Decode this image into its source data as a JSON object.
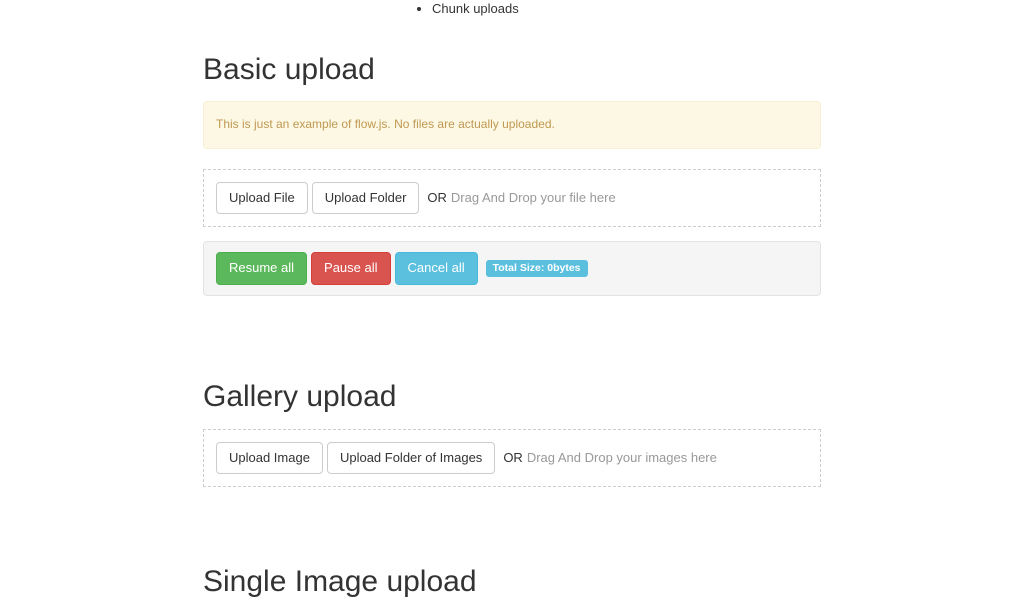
{
  "nav": {
    "items": [
      "Chunk uploads"
    ]
  },
  "basic": {
    "heading": "Basic upload",
    "alert": "This is just an example of flow.js. No files are actually uploaded.",
    "upload_file": "Upload File",
    "upload_folder": "Upload Folder",
    "or": "OR",
    "drag_hint": "Drag And Drop your file here",
    "resume_all": "Resume all",
    "pause_all": "Pause all",
    "cancel_all": "Cancel all",
    "total_size": "Total Size: 0bytes"
  },
  "gallery": {
    "heading": "Gallery upload",
    "upload_image": "Upload Image",
    "upload_folder": "Upload Folder of Images",
    "or": "OR",
    "drag_hint": "Drag And Drop your images here"
  },
  "single": {
    "heading": "Single Image upload"
  }
}
